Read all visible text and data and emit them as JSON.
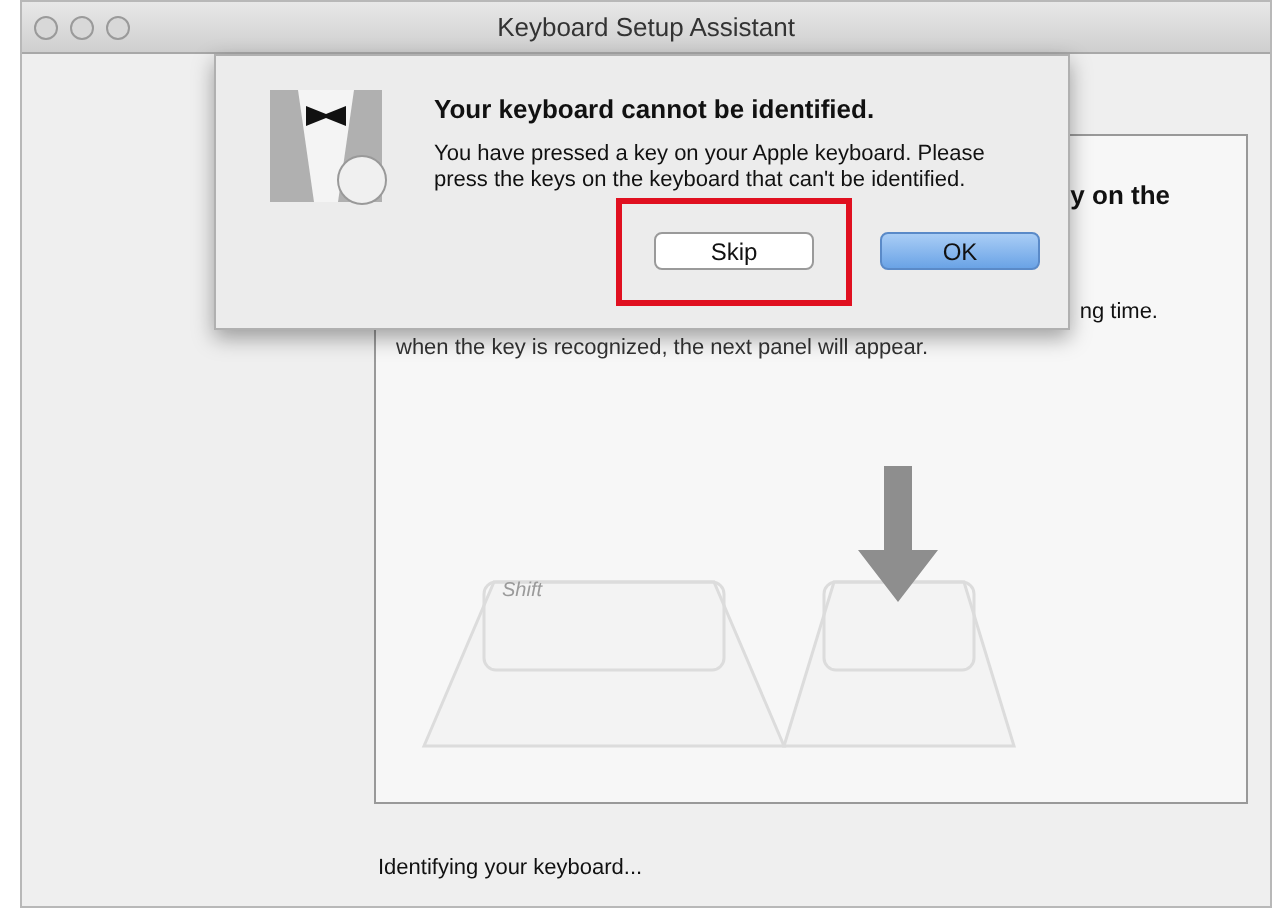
{
  "window": {
    "title": "Keyboard Setup Assistant"
  },
  "panel": {
    "heading_fragment": "y on the",
    "note_fragment": "ng time.",
    "note_line": "when the key is recognized, the next panel will appear.",
    "key_label": "Shift"
  },
  "status": "Identifying your keyboard...",
  "alert": {
    "title": "Your keyboard cannot be identified.",
    "message": "You have pressed a key on your Apple keyboard. Please press the keys on the keyboard that can't be identified.",
    "buttons": [
      {
        "label": "Skip",
        "default": false,
        "highlighted": true
      },
      {
        "label": "OK",
        "default": true,
        "highlighted": false
      }
    ]
  }
}
